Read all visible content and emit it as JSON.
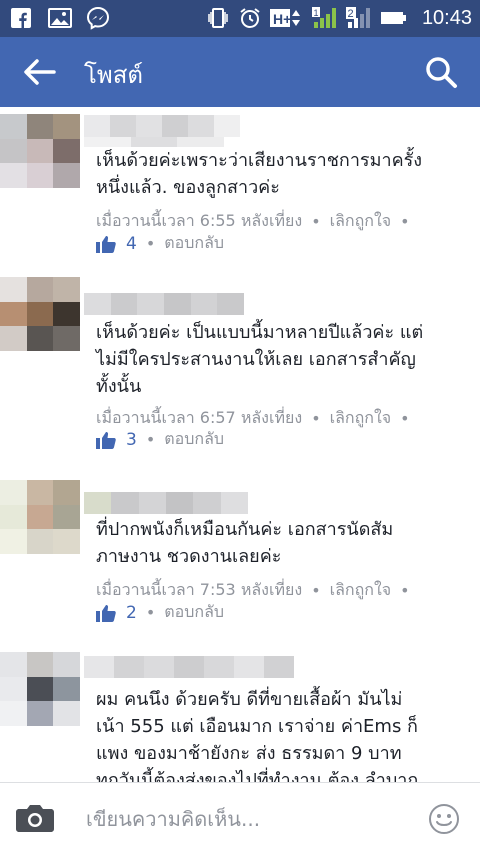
{
  "status_bar": {
    "time": "10:43",
    "network": "H+",
    "sim2": "2"
  },
  "header": {
    "title": "โพสต์"
  },
  "comments": [
    {
      "text": "เห็นด้วยค่ะเพราะว่าเสียงานราชการมาครั้ง\nหนึ่งแล้ว. ของลูกสาวค่ะ",
      "timestamp": "เมื่อวานนี้เวลา 6:55 หลังเที่ยง",
      "unlike_label": "เลิกถูกใจ",
      "likes": "4",
      "reply_label": "ตอบกลับ"
    },
    {
      "text": "เห็นด้วยค่ะ เป็นแบบนี้มาหลายปีแล้วค่ะ แต่\nไม่มีใครประสานงานให้เลย เอกสารสำคัญ\nทั้งนั้น",
      "timestamp": "เมื่อวานนี้เวลา 6:57 หลังเที่ยง",
      "unlike_label": "เลิกถูกใจ",
      "likes": "3",
      "reply_label": "ตอบกลับ"
    },
    {
      "text": "ที่ปากพนังก็เหมือนกันค่ะ เอกสารนัดสัม\nภาษงาน  ชวดงานเลยค่ะ",
      "timestamp": "เมื่อวานนี้เวลา 7:53 หลังเที่ยง",
      "unlike_label": "เลิกถูกใจ",
      "likes": "2",
      "reply_label": "ตอบกลับ"
    },
    {
      "text": "ผม คนนึง ด้วยครับ ดีที่ขายเสื้อผ้า มันไม่\nเน้า 555 แต่ เอือนมาก เราจ่าย ค่าEms ก็\nแพง ของมาช้ายังกะ ส่ง ธรรมดา 9 บาท\nทุกวันนี้ต้องส่งของไปที่ทำงาน ต้อง ลำบาก"
    }
  ],
  "composer": {
    "placeholder": "เขียนความคิดเห็น..."
  },
  "colors": {
    "status_bar": "#324a7d",
    "app_bar": "#4267b2",
    "like_blue": "#4267b2",
    "meta_gray": "#90949c"
  },
  "icons": [
    "facebook-icon",
    "gallery-icon",
    "messenger-icon",
    "vibrate-icon",
    "alarm-icon",
    "signal-icon",
    "battery-icon",
    "back-arrow-icon",
    "search-icon",
    "like-thumb-icon",
    "camera-icon",
    "emoji-icon"
  ]
}
